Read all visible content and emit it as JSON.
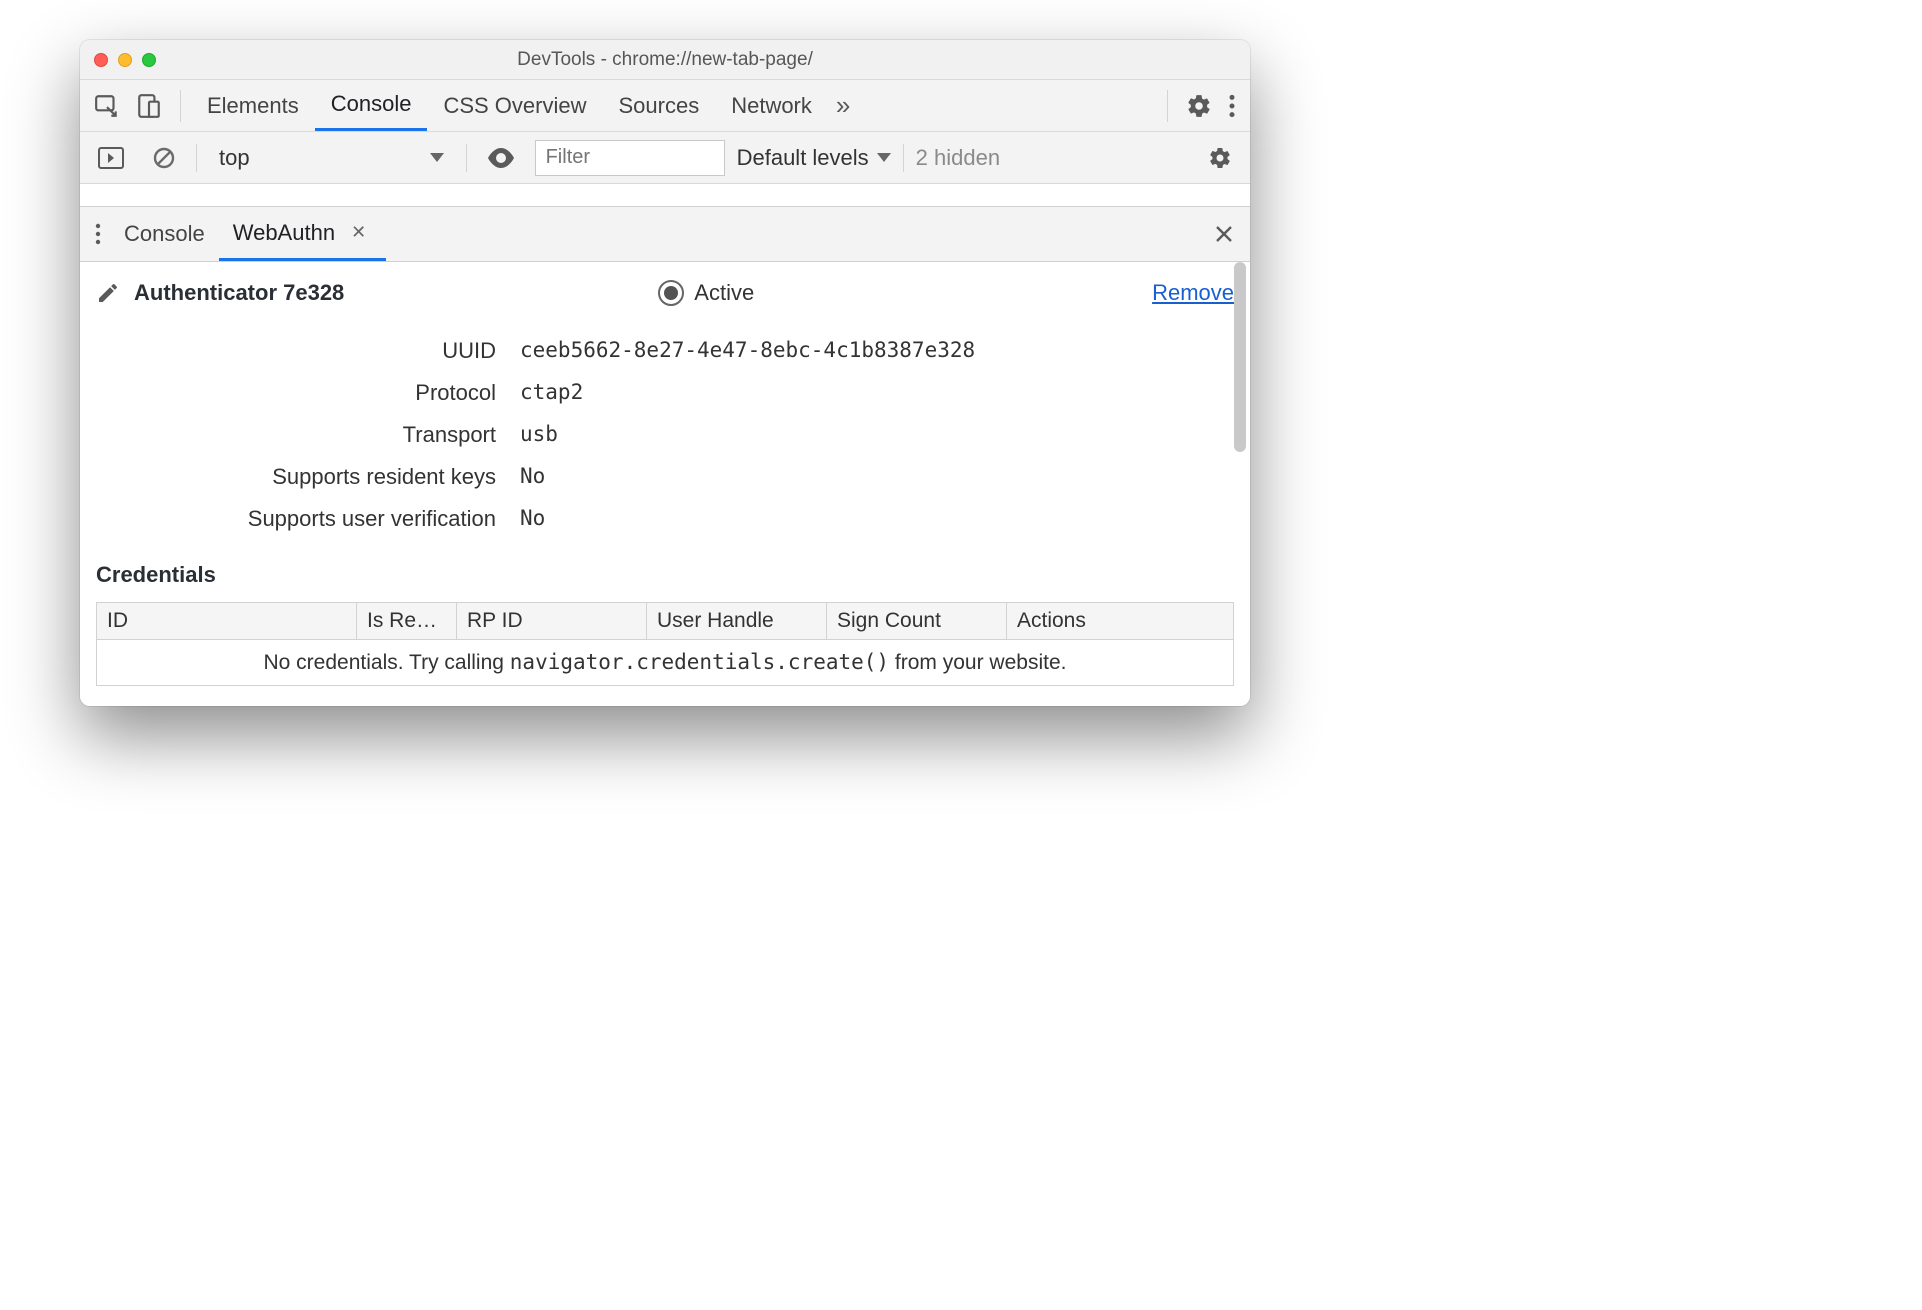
{
  "window": {
    "title": "DevTools - chrome://new-tab-page/"
  },
  "tabs": {
    "items": [
      "Elements",
      "Console",
      "CSS Overview",
      "Sources",
      "Network"
    ],
    "active_index": 1
  },
  "console_toolbar": {
    "context": "top",
    "filter_placeholder": "Filter",
    "levels_label": "Default levels",
    "hidden_count": "2 hidden"
  },
  "drawer": {
    "tabs": [
      "Console",
      "WebAuthn"
    ],
    "active_index": 1
  },
  "authenticator": {
    "name": "Authenticator 7e328",
    "active_label": "Active",
    "remove_label": "Remove",
    "fields": {
      "uuid_label": "UUID",
      "uuid": "ceeb5662-8e27-4e47-8ebc-4c1b8387e328",
      "protocol_label": "Protocol",
      "protocol": "ctap2",
      "transport_label": "Transport",
      "transport": "usb",
      "resident_label": "Supports resident keys",
      "resident": "No",
      "userverif_label": "Supports user verification",
      "userverif": "No"
    }
  },
  "credentials": {
    "heading": "Credentials",
    "columns": [
      "ID",
      "Is Re…",
      "RP ID",
      "User Handle",
      "Sign Count",
      "Actions"
    ],
    "empty_prefix": "No credentials. Try calling ",
    "empty_code": "navigator.credentials.create()",
    "empty_suffix": " from your website."
  }
}
